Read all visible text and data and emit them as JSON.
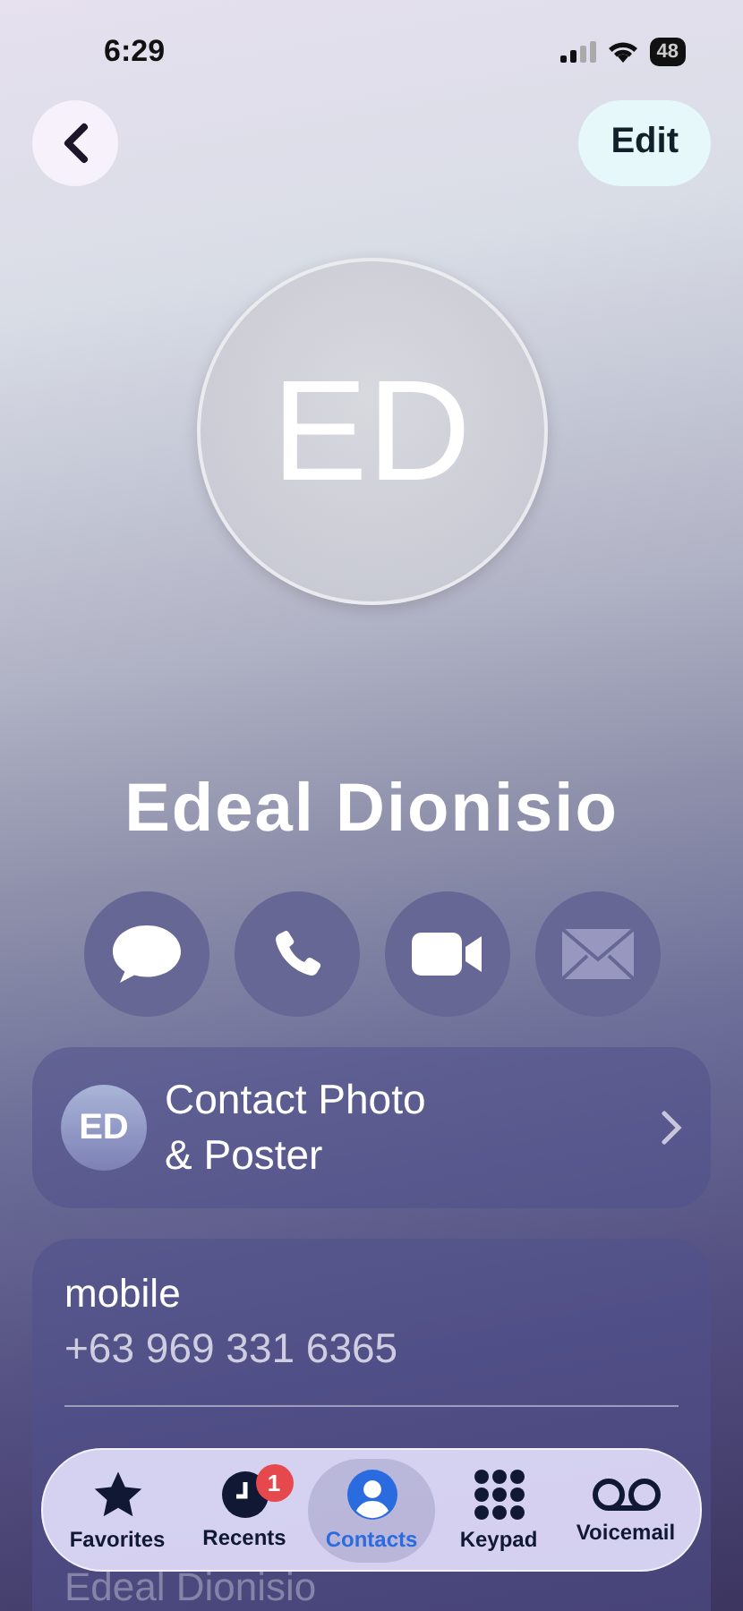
{
  "status_bar": {
    "time": "6:29",
    "battery": "48"
  },
  "nav": {
    "edit": "Edit"
  },
  "contact": {
    "initials": "ED",
    "name": "Edeal Dionisio"
  },
  "actions": [
    {
      "kind": "message",
      "disabled": false
    },
    {
      "kind": "call",
      "disabled": false
    },
    {
      "kind": "video",
      "disabled": false
    },
    {
      "kind": "mail",
      "disabled": true
    }
  ],
  "poster_row": {
    "initials": "ED",
    "label": "Contact Photo\n& Poster"
  },
  "phone": {
    "label": "mobile",
    "number": "+63 969 331 6365"
  },
  "behind_text": "Edeal  Dionisio",
  "tabs": [
    {
      "kind": "favorites",
      "label": "Favorites",
      "selected": false
    },
    {
      "kind": "recents",
      "label": "Recents",
      "selected": false,
      "badge": "1"
    },
    {
      "kind": "contacts",
      "label": "Contacts",
      "selected": true
    },
    {
      "kind": "keypad",
      "label": "Keypad",
      "selected": false
    },
    {
      "kind": "voicemail",
      "label": "Voicemail",
      "selected": false
    }
  ]
}
